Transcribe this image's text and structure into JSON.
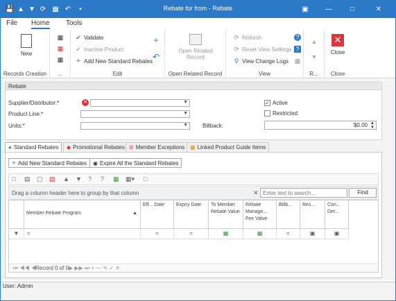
{
  "window": {
    "title": "Rebate for  from  - Rebate",
    "quick_icons": [
      "save-icon",
      "up-icon",
      "down-icon",
      "refresh-icon",
      "save-close-icon",
      "undo-icon",
      "dropdown-icon"
    ],
    "controls": [
      "window-icon",
      "minimize",
      "maximize",
      "close"
    ]
  },
  "menu": {
    "items": [
      "File",
      "Home",
      "Tools"
    ],
    "active": "Home"
  },
  "ribbon": {
    "new_label": "New",
    "records_creation": "Records Creation",
    "dots": "...",
    "validate": "Validate",
    "inactive_product": "Inactive Product",
    "add_new_standard_rebates": "Add New Standard Rebates",
    "edit": "Edit",
    "open_related_record_btn": "Open Related Record",
    "open_related_record": "Open Related Record",
    "refresh": "Refresh",
    "reset_view_settings": "Reset View Settings",
    "view_change_logs": "View Change Logs",
    "view": "View",
    "r_group": "R...",
    "close_label": "Close",
    "close_group": "Close"
  },
  "rebate_panel": {
    "header": "Rebate",
    "supplier_label": "Supplier/Distributor:*",
    "product_line_label": "Product Line:*",
    "units_label": "Units:*",
    "active_label": "Active",
    "active_checked": true,
    "restricted_label": "Restricted",
    "restricted_checked": false,
    "billback_label": "Billback:",
    "billback_value": "$0.00"
  },
  "tabs": [
    "Standard Rebates",
    "Promotional Rebates",
    "Member Exceptions",
    "Linked Product Guide Items"
  ],
  "tab_active": "Standard Rebates",
  "grid_actions": {
    "add_new": "Add New Standard Rebates",
    "expire_all": "Expire All the Standard Rebates"
  },
  "grid": {
    "group_hint": "Drag a column header here to group by that column",
    "search_placeholder": "Enter text to search...",
    "find": "Find",
    "columns": [
      "Member Rebate Program",
      "Eff... Date",
      "Expiry Date",
      "To Member Rebate Value",
      "Rebate Manage... Fee Value",
      "Billb...",
      "Res...",
      "Con... Det..."
    ],
    "filter_ops": [
      "=",
      "=",
      "=",
      "",
      "",
      "=",
      "",
      ""
    ],
    "nav_text": "Record 0 of 0"
  },
  "status": {
    "user": "User: Admin"
  }
}
